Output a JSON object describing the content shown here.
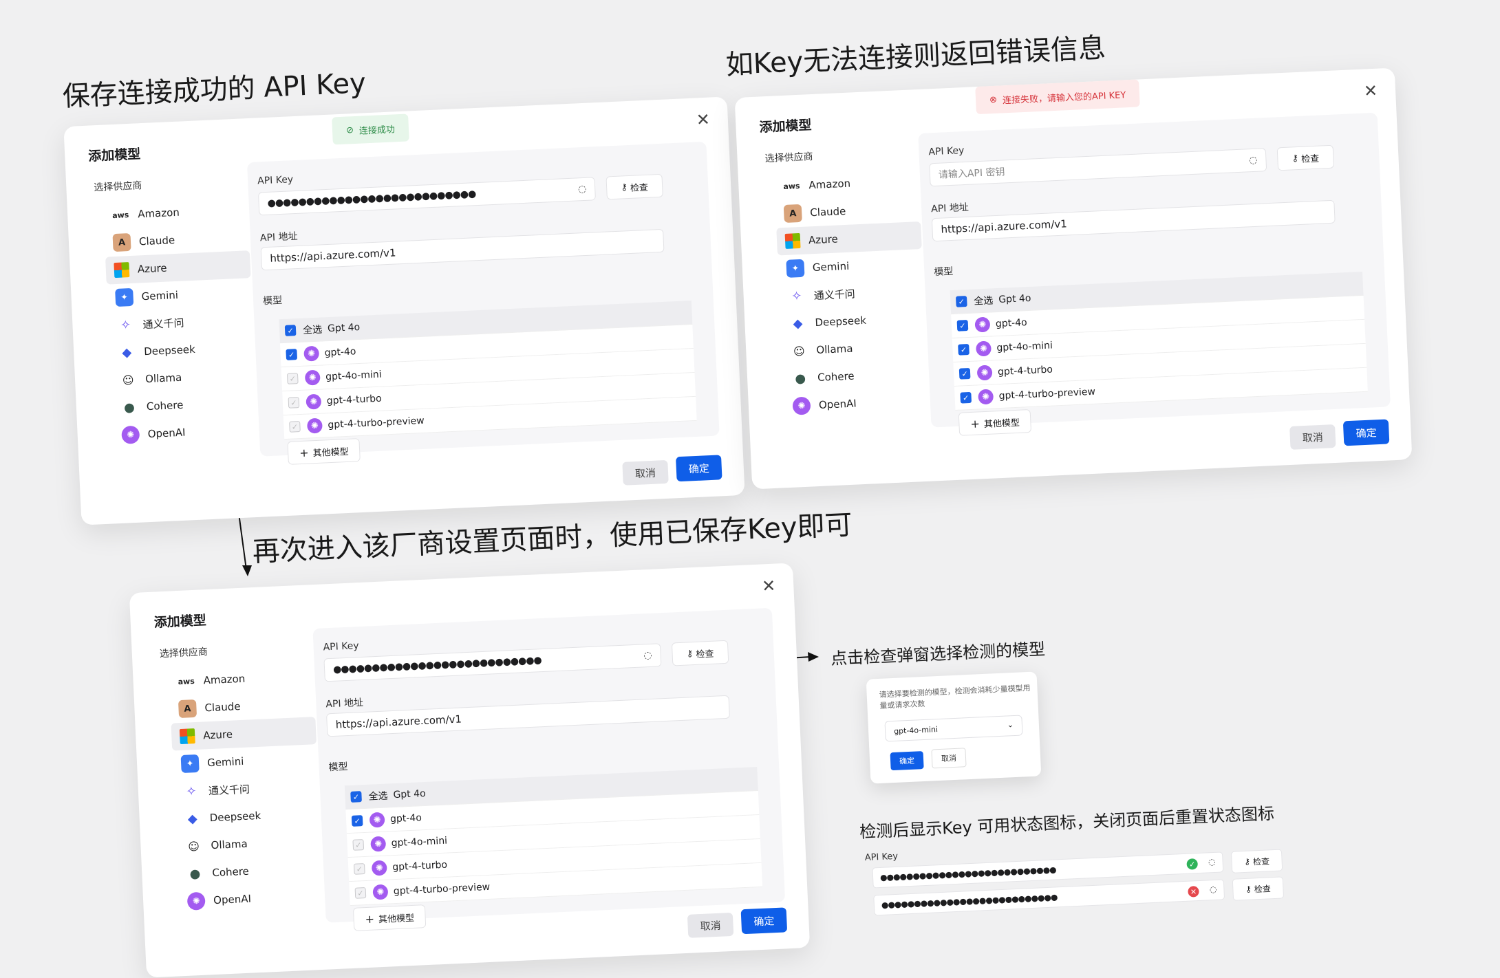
{
  "headings": {
    "h1": "保存连接成功的 API Key",
    "h2": "如Key无法连接则返回错误信息",
    "h3": "再次进入该厂商设置页面时，使用已保存Key即可",
    "h4": "点击检查弹窗选择检测的模型",
    "h5": "检测后显示Key 可用状态图标，关闭页面后重置状态图标"
  },
  "dialog": {
    "title": "添加模型",
    "vendor_label": "选择供应商",
    "api_key_label": "API Key",
    "api_key_masked": "●●●●●●●●●●●●●●●●●●●●●●●●●●●",
    "api_key_placeholder": "请输入API 密钥",
    "check_label": "检查",
    "api_url_label": "API 地址",
    "api_url_value": "https://api.azure.com/v1",
    "models_label": "模型",
    "select_all": "全选",
    "group_name": "Gpt 4o",
    "models": [
      "gpt-4o",
      "gpt-4o-mini",
      "gpt-4-turbo",
      "gpt-4-turbo-preview"
    ],
    "other_models": "其他模型",
    "cancel": "取消",
    "confirm": "确定",
    "vendors": [
      {
        "name": "Amazon",
        "icon": "aws-logo-icon"
      },
      {
        "name": "Claude",
        "icon": "claude-logo-icon"
      },
      {
        "name": "Azure",
        "icon": "microsoft-logo-icon"
      },
      {
        "name": "Gemini",
        "icon": "gemini-logo-icon"
      },
      {
        "name": "通义千问",
        "icon": "tongyi-logo-icon"
      },
      {
        "name": "Deepseek",
        "icon": "deepseek-logo-icon"
      },
      {
        "name": "Ollama",
        "icon": "ollama-logo-icon"
      },
      {
        "name": "Cohere",
        "icon": "cohere-logo-icon"
      },
      {
        "name": "OpenAI",
        "icon": "openai-logo-icon"
      }
    ],
    "selected_vendor": "Azure"
  },
  "toasts": {
    "success": "连接成功",
    "error": "连接失败，请输入您的API KEY"
  },
  "popup": {
    "text": "请选择要检测的模型，检测会消耗少量模型用量或请求次数",
    "selected_model": "gpt-4o-mini",
    "confirm": "确定",
    "cancel": "取消"
  },
  "status_demo": {
    "label": "API Key",
    "masked": "●●●●●●●●●●●●●●●●●●●●●●●●●●●",
    "check": "检查"
  },
  "colors": {
    "primary": "#0f5ee8",
    "success": "#2fb35a",
    "error": "#e5484d",
    "openai": "#a35bf0"
  }
}
